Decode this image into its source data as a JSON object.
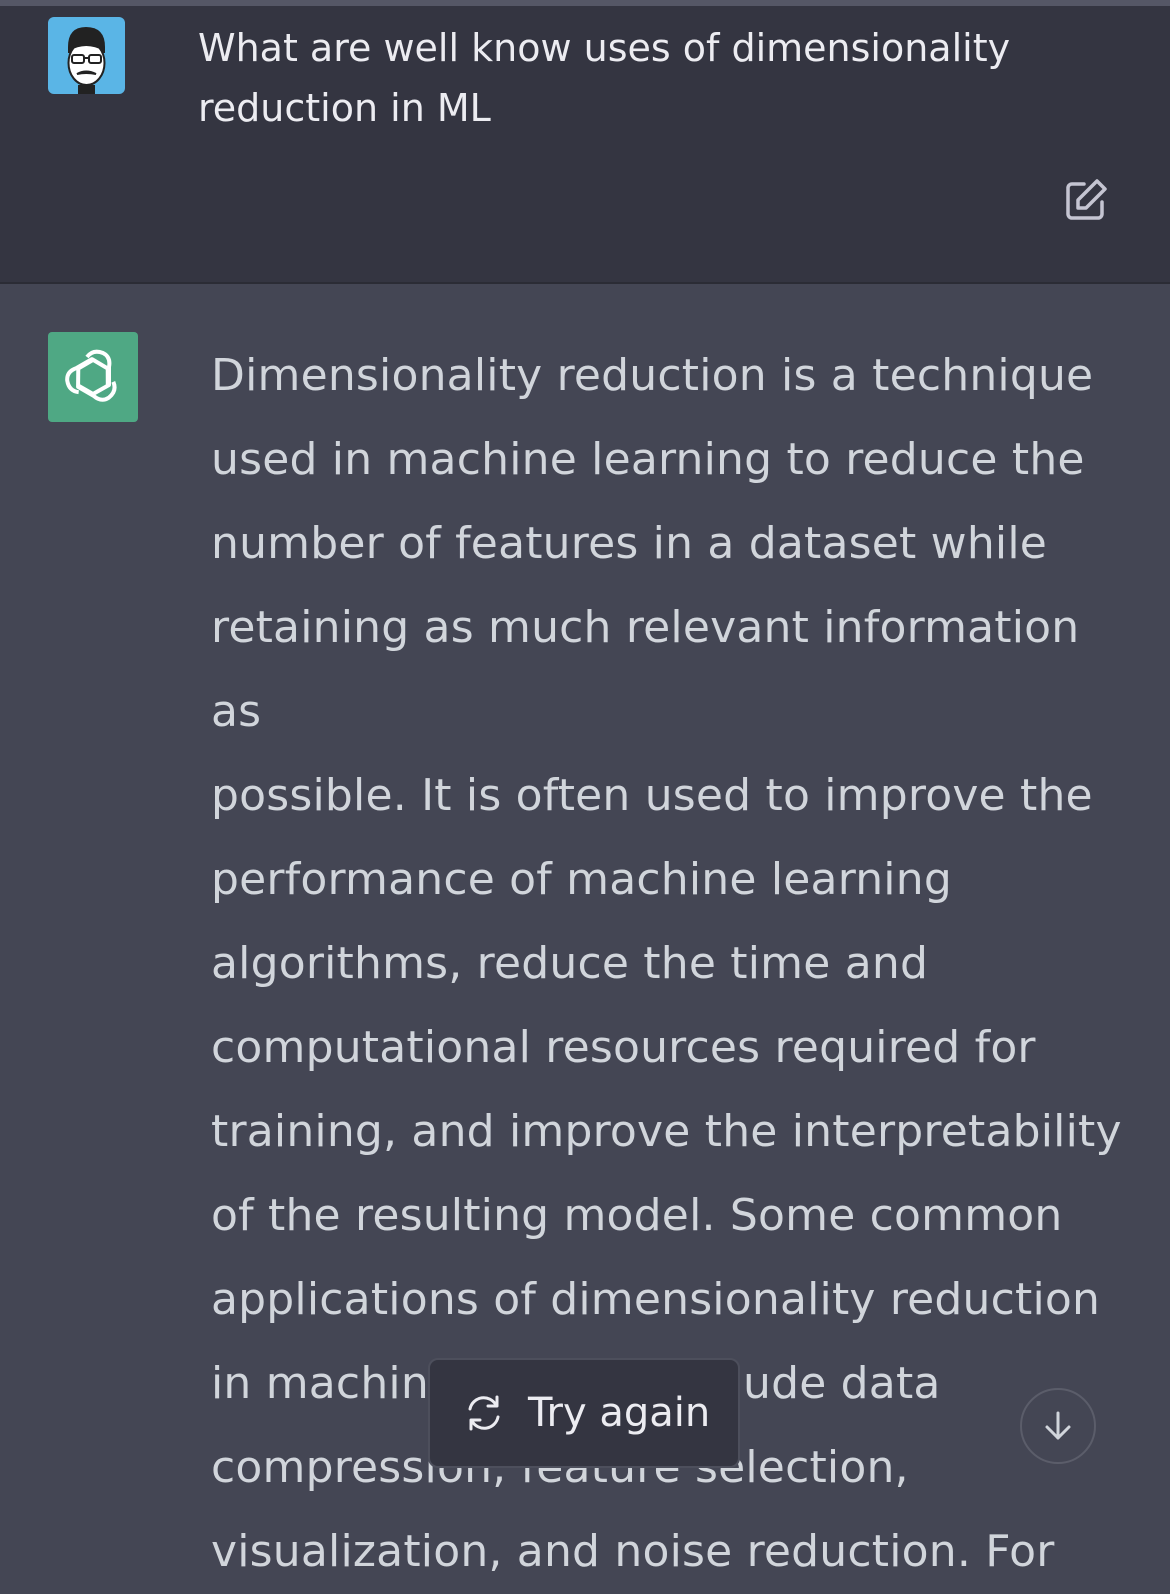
{
  "user_message": {
    "text": "What are well know uses of dimensionality reduction in ML",
    "avatar_icon": "user-avatar-glasses-mustache",
    "edit_icon": "edit-icon"
  },
  "assistant_message": {
    "logo_icon": "openai-logo-icon",
    "lines": [
      "Dimensionality reduction is a technique",
      "used in machine learning to reduce the",
      "number of features in a dataset while",
      "retaining as much relevant information as",
      "possible. It is often used to improve the",
      "performance of machine learning",
      "algorithms, reduce the time and",
      "computational resources required for",
      "training, and improve the interpretability",
      "of the resulting model. Some common",
      "applications of dimensionality reduction",
      "in machine learning include data",
      "compression, feature selection,",
      "visualization, and noise reduction. For"
    ]
  },
  "controls": {
    "try_again_label": "Try again",
    "try_again_icon": "refresh-icon",
    "scroll_down_icon": "arrow-down-icon"
  },
  "colors": {
    "user_bg": "#343541",
    "assistant_bg": "#444654",
    "logo_green": "#4fa884",
    "avatar_blue": "#5ab5e6"
  }
}
